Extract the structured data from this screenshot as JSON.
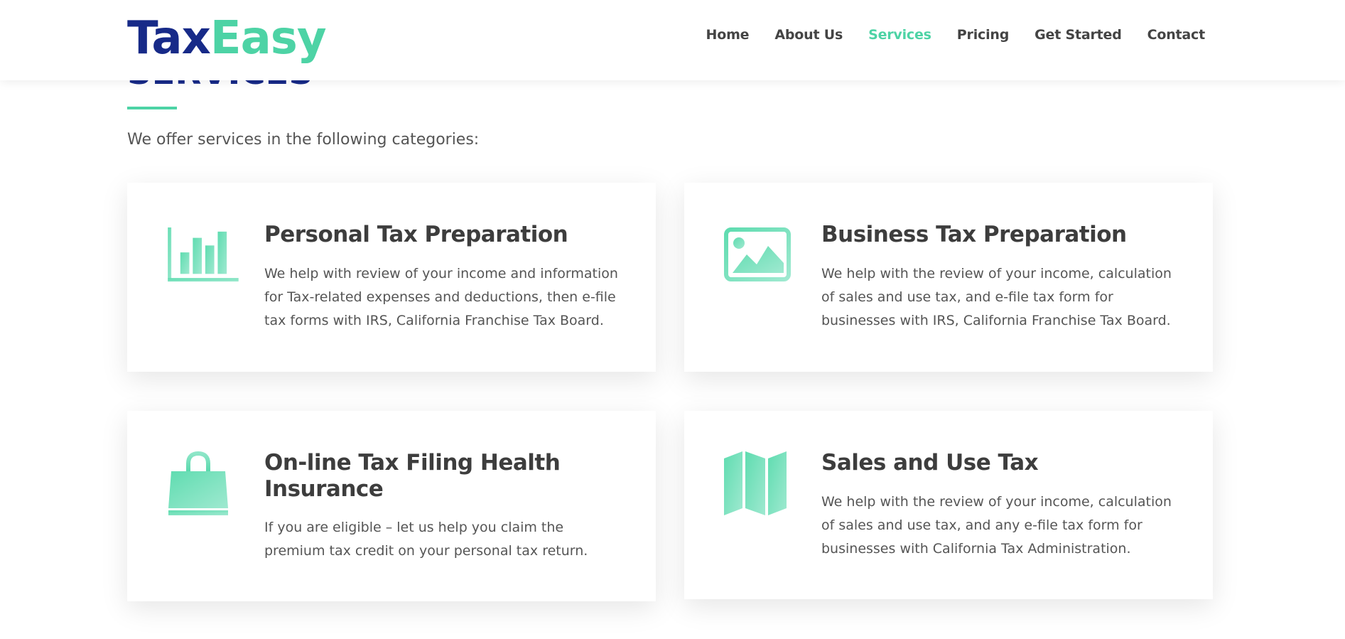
{
  "brand": {
    "logo_part1": "Tax",
    "logo_part2": "Easy",
    "primary_color": "#172a88",
    "accent_color": "#4dd3a5"
  },
  "nav": {
    "items": [
      {
        "label": "Home"
      },
      {
        "label": "About Us"
      },
      {
        "label": "Services",
        "active": true
      },
      {
        "label": "Pricing"
      },
      {
        "label": "Get Started"
      },
      {
        "label": "Contact"
      }
    ]
  },
  "section": {
    "title": "SERVICES",
    "intro": "We offer services in the following categories:"
  },
  "cards": [
    {
      "icon": "bar-chart-icon",
      "title": "Personal Tax Preparation",
      "text": "We help with review of your income and information for Tax-related expenses and deductions, then e-file tax forms with IRS, California Franchise Tax Board."
    },
    {
      "icon": "image-icon",
      "title": "Business Tax Preparation",
      "text": "We help with the review of your income, calculation of sales and use tax, and e-file tax form for businesses with IRS, California Franchise Tax Board."
    },
    {
      "icon": "shopping-bag-icon",
      "title": "On-line Tax Filing Health Insurance",
      "text": "If you are eligible – let us help you claim the premium tax credit on your personal tax return."
    },
    {
      "icon": "map-icon",
      "title": "Sales and Use Tax",
      "text": "We help with the review of your income, calculation of sales and use tax, and any e-file tax form for businesses with California Tax Administration."
    }
  ]
}
